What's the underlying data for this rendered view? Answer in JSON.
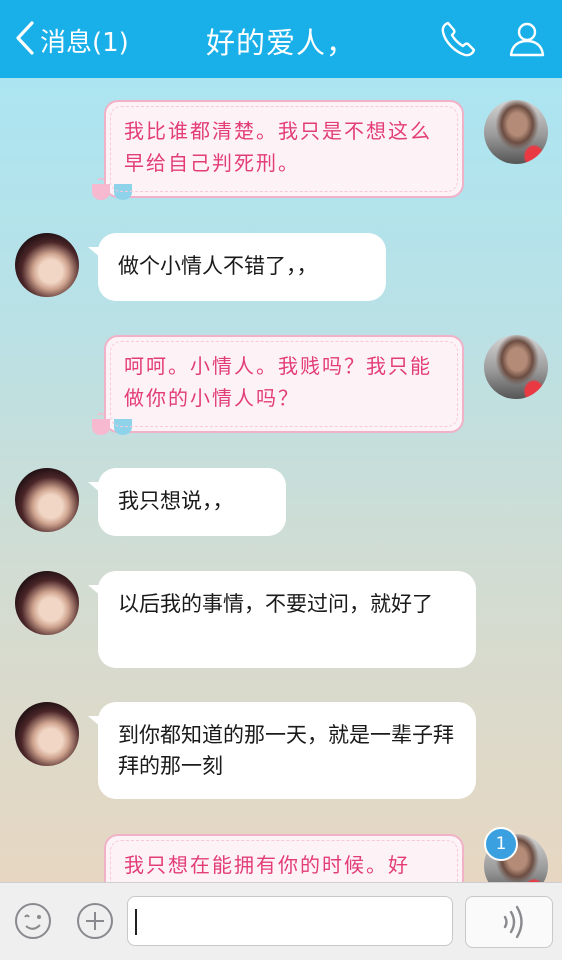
{
  "header": {
    "back_label": "消息(1)",
    "title": "好的爱人，",
    "background": "#19b0ea"
  },
  "messages": [
    {
      "side": "right",
      "style": "decorated",
      "text": "我比谁都清楚。我只是不想这么早给自己判死刑。"
    },
    {
      "side": "left",
      "style": "plain",
      "text": "做个小情人不错了，，"
    },
    {
      "side": "right",
      "style": "decorated",
      "text": "呵呵。小情人。我贱吗？我只能做你的小情人吗？"
    },
    {
      "side": "left",
      "style": "plain",
      "text": "我只想说，，"
    },
    {
      "side": "left",
      "style": "plain",
      "text": "以后我的事情，不要过问，就好了"
    },
    {
      "side": "left",
      "style": "plain",
      "text": "到你都知道的那一天，就是一辈子拜拜的那一刻"
    },
    {
      "side": "right",
      "style": "decorated",
      "text": "我只想在能拥有你的时候。好"
    }
  ],
  "unread_badge": "1",
  "input": {
    "value": "",
    "placeholder": ""
  },
  "icons": {
    "back": "chevron-left-icon",
    "call": "phone-icon",
    "profile": "person-icon",
    "emoji": "smiley-icon",
    "more": "plus-circle-icon",
    "voice": "voice-icon"
  },
  "colors": {
    "bubble_text": "#1a1a1a",
    "decorated_text": "#e33d77",
    "decorated_border": "#f1b1c8"
  }
}
